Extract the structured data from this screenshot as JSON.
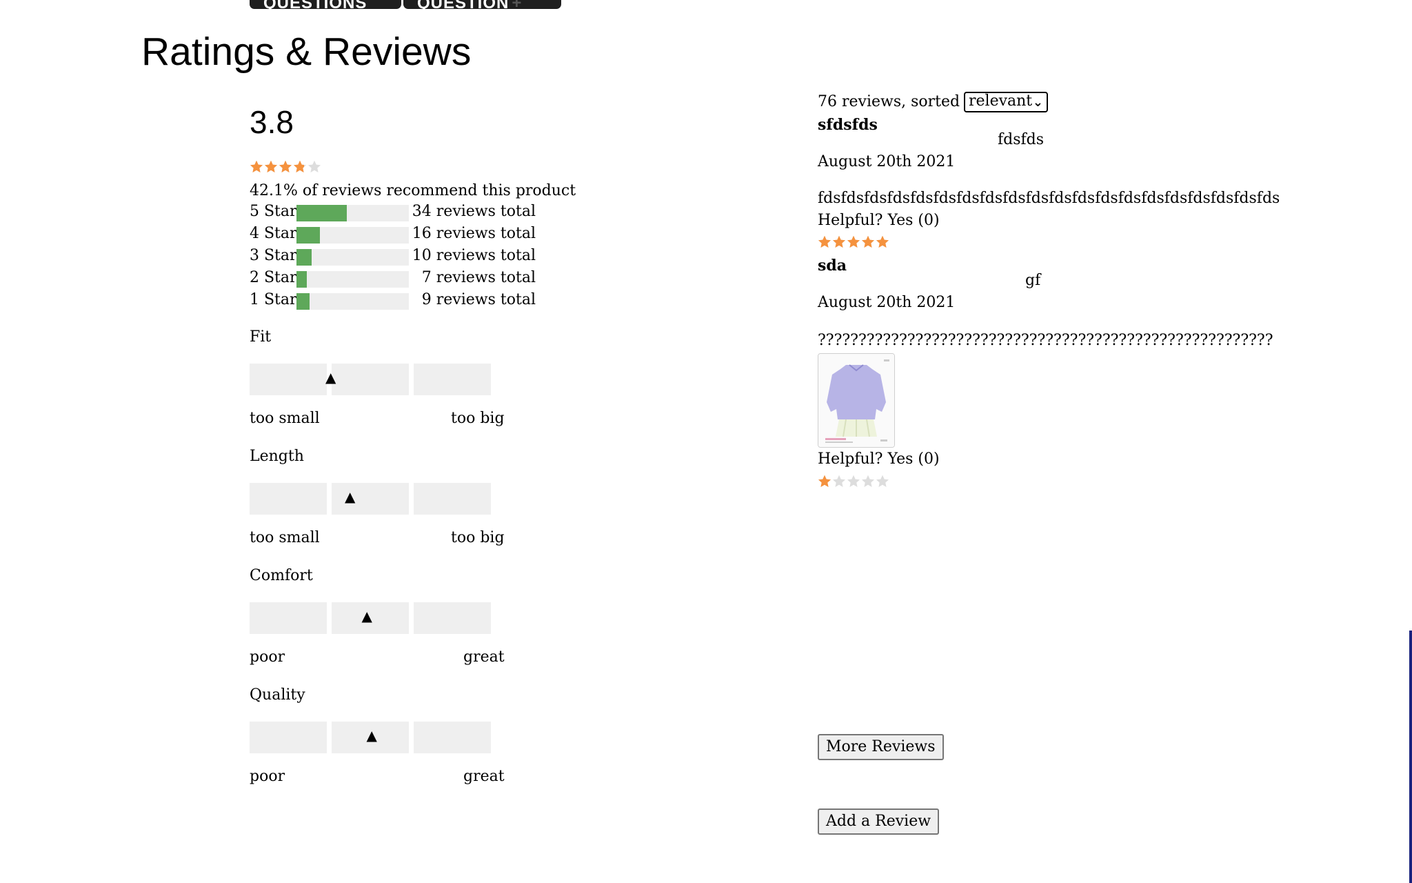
{
  "top_buttons": [
    {
      "label": "QUESTIONS"
    },
    {
      "label": "QUESTION",
      "suffix": "+"
    }
  ],
  "title": "Ratings & Reviews",
  "summary": {
    "average": "3.8",
    "average_rating": 3.8,
    "recommend_text": "42.1% of reviews recommend this product",
    "star_color": "#f5923e",
    "bar_color": "#5ea85a",
    "breakdown": [
      {
        "label": "5 Stars",
        "total_text": "34 reviews total",
        "fraction": 0.447
      },
      {
        "label": "4 Stars",
        "total_text": "16 reviews total",
        "fraction": 0.211
      },
      {
        "label": "3 Stars",
        "total_text": "10 reviews total",
        "fraction": 0.132
      },
      {
        "label": "2 Stars",
        "total_text": "7 reviews total",
        "fraction": 0.092
      },
      {
        "label": "1 Stars",
        "total_text": "9 reviews total",
        "fraction": 0.118
      }
    ]
  },
  "characteristics": [
    {
      "name": "Fit",
      "low": "too small",
      "high": "too big",
      "marker_fraction": 0.34
    },
    {
      "name": "Length",
      "low": "too small",
      "high": "too big",
      "marker_fraction": 0.42
    },
    {
      "name": "Comfort",
      "low": "poor",
      "high": "great",
      "marker_fraction": 0.49
    },
    {
      "name": "Quality",
      "low": "poor",
      "high": "great",
      "marker_fraction": 0.51
    }
  ],
  "reviews_header": {
    "count_text": "76 reviews, sorted by",
    "sort_selected": "relevant"
  },
  "reviews": [
    {
      "summary": "sfdsfds",
      "username": "fdsfds",
      "date": "August 20th 2021",
      "body": "fdsfdsfdsfdsfdsfdsfdsfdsfdsfdsfdsfdsfdsfdsfdsfdsfdsfdsfdsfds",
      "helpful": "Helpful? Yes (0)",
      "rating": 5
    },
    {
      "summary": "sda",
      "username": "gf",
      "date": "August 20th 2021",
      "body": "????????????????????????????????????????????????????????",
      "helpful": "Helpful? Yes (0)",
      "rating": 1,
      "has_photo": true
    }
  ],
  "buttons": {
    "more_reviews": "More Reviews",
    "add_review": "Add a Review"
  }
}
